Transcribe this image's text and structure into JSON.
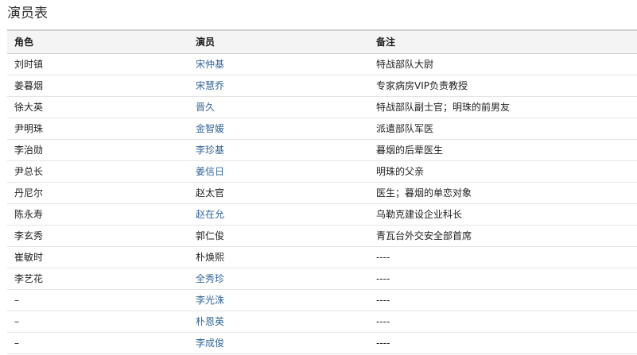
{
  "title": "演员表",
  "headers": {
    "role": "角色",
    "actor": "演员",
    "note": "备注"
  },
  "colors": {
    "link": "#336699",
    "text": "#222222",
    "header_bg": "#f4f4f4"
  },
  "rows": [
    {
      "role": "刘时镇",
      "actor": "宋仲基",
      "actor_linked": true,
      "note": "特战部队大尉"
    },
    {
      "role": "姜暮烟",
      "actor": "宋慧乔",
      "actor_linked": true,
      "note": "专家病房VIP负责教授"
    },
    {
      "role": "徐大英",
      "actor": "晋久",
      "actor_linked": true,
      "note": "特战部队副士官；明珠的前男友"
    },
    {
      "role": "尹明珠",
      "actor": "金智媛",
      "actor_linked": true,
      "note": "派遣部队军医"
    },
    {
      "role": "李治勋",
      "actor": "李珍基",
      "actor_linked": true,
      "note": "暮烟的后辈医生"
    },
    {
      "role": "尹总长",
      "actor": "姜信日",
      "actor_linked": true,
      "note": "明珠的父亲"
    },
    {
      "role": "丹尼尔",
      "actor": "赵太官",
      "actor_linked": false,
      "note": "医生；暮烟的单恋对象"
    },
    {
      "role": "陈永寿",
      "actor": "赵在允",
      "actor_linked": true,
      "note": "乌勒克建设企业科长"
    },
    {
      "role": "李玄秀",
      "actor": "郭仁俊",
      "actor_linked": false,
      "note": "青瓦台外交安全部首席"
    },
    {
      "role": "崔敏时",
      "actor": "朴焕熙",
      "actor_linked": false,
      "note": "----"
    },
    {
      "role": "李艺花",
      "actor": "全秀珍",
      "actor_linked": true,
      "note": "----"
    },
    {
      "role": "–",
      "actor": "李光洙",
      "actor_linked": true,
      "note": "----"
    },
    {
      "role": "–",
      "actor": "朴恩英",
      "actor_linked": true,
      "note": "----"
    },
    {
      "role": "–",
      "actor": "李成俊",
      "actor_linked": true,
      "note": "----"
    }
  ]
}
